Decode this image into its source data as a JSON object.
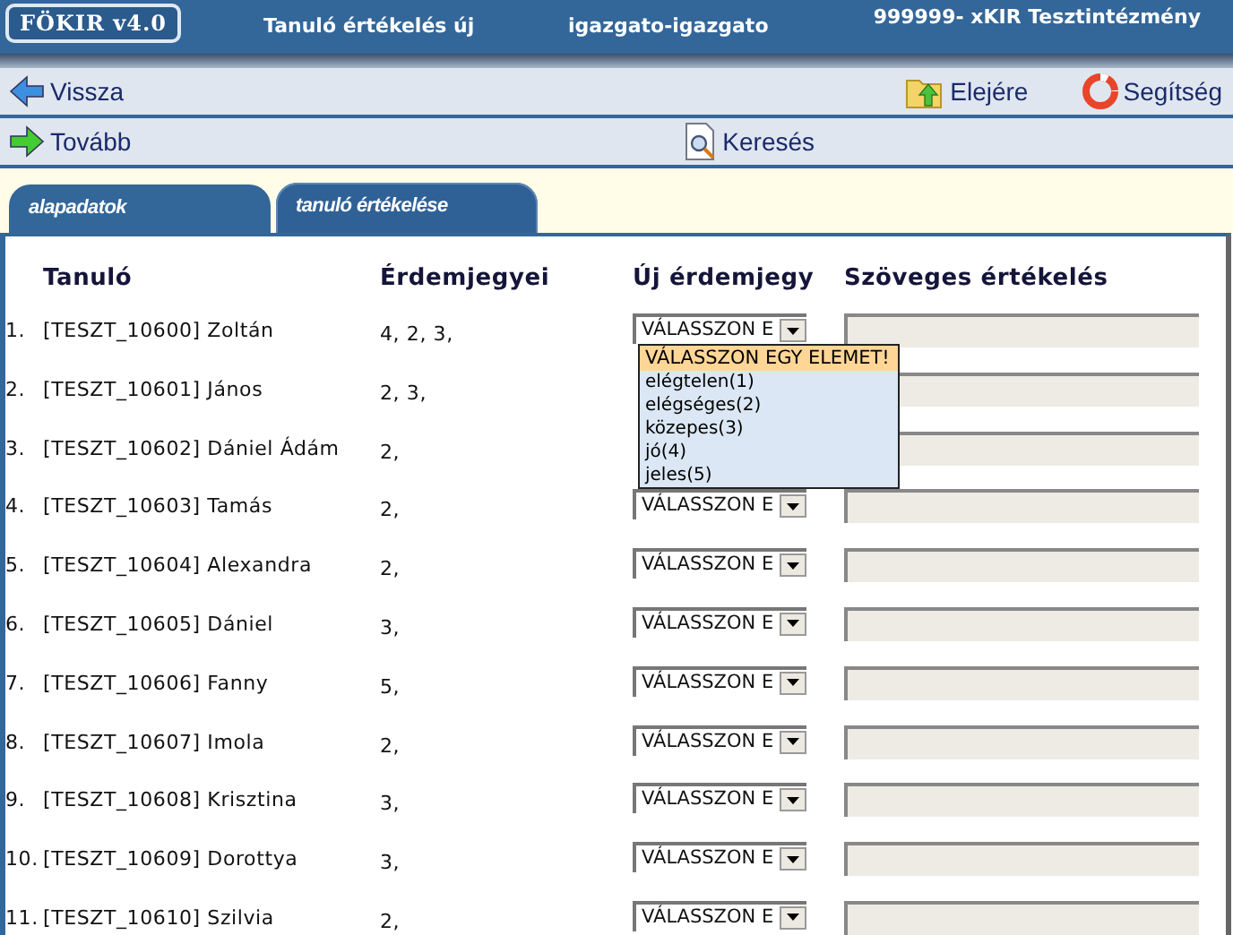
{
  "header": {
    "logo": "FÖKIR v4.0",
    "page_title": "Tanuló értékelés új",
    "user": "igazgato-igazgato",
    "institution": "999999- xKIR Tesztintézmény"
  },
  "toolbar": {
    "back": "Vissza",
    "top": "Elejére",
    "help": "Segítség",
    "next": "Tovább",
    "search": "Keresés"
  },
  "tabs": [
    {
      "label": "alapadatok",
      "selected": false
    },
    {
      "label": "tanuló értékelése",
      "selected": true
    }
  ],
  "table": {
    "columns": [
      "Tanuló",
      "Érdemjegyei",
      "Új érdemjegy",
      "Szöveges értékelés"
    ],
    "rows": [
      {
        "number": "1.",
        "student": "[TESZT_10600] Zoltán",
        "grades": "4, 2, 3,",
        "select": "VÁLASSZON E"
      },
      {
        "number": "2.",
        "student": "[TESZT_10601] János",
        "grades": "2, 3,"
      },
      {
        "number": "3.",
        "student": "[TESZT_10602] Dániel Ádám",
        "grades": "2,"
      },
      {
        "number": "4.",
        "student": "[TESZT_10603] Tamás",
        "grades": "2,",
        "select": "VÁLASSZON E"
      },
      {
        "number": "5.",
        "student": "[TESZT_10604] Alexandra",
        "grades": "2,",
        "select": "VÁLASSZON E"
      },
      {
        "number": "6.",
        "student": "[TESZT_10605] Dániel",
        "grades": "3,",
        "select": "VÁLASSZON E"
      },
      {
        "number": "7.",
        "student": "[TESZT_10606] Fanny",
        "grades": "5,",
        "select": "VÁLASSZON E"
      },
      {
        "number": "8.",
        "student": "[TESZT_10607] Imola",
        "grades": "2,",
        "select": "VÁLASSZON E"
      },
      {
        "number": "9.",
        "student": "[TESZT_10608] Krisztina",
        "grades": "3,",
        "select": "VÁLASSZON E"
      },
      {
        "number": "10.",
        "student": "[TESZT_10609] Dorottya",
        "grades": "3,",
        "select": "VÁLASSZON E"
      },
      {
        "number": "11.",
        "student": "[TESZT_10610] Szilvia",
        "grades": "2,",
        "select": "VÁLASSZON E"
      }
    ]
  },
  "dropdown": {
    "options": [
      {
        "label": "VÁLASSZON EGY ELEMET!",
        "selected": true
      },
      {
        "label": "elégtelen(1)",
        "selected": false
      },
      {
        "label": "elégséges(2)",
        "selected": false
      },
      {
        "label": "közepes(3)",
        "selected": false
      },
      {
        "label": "jó(4)",
        "selected": false
      },
      {
        "label": "jeles(5)",
        "selected": false
      }
    ]
  }
}
